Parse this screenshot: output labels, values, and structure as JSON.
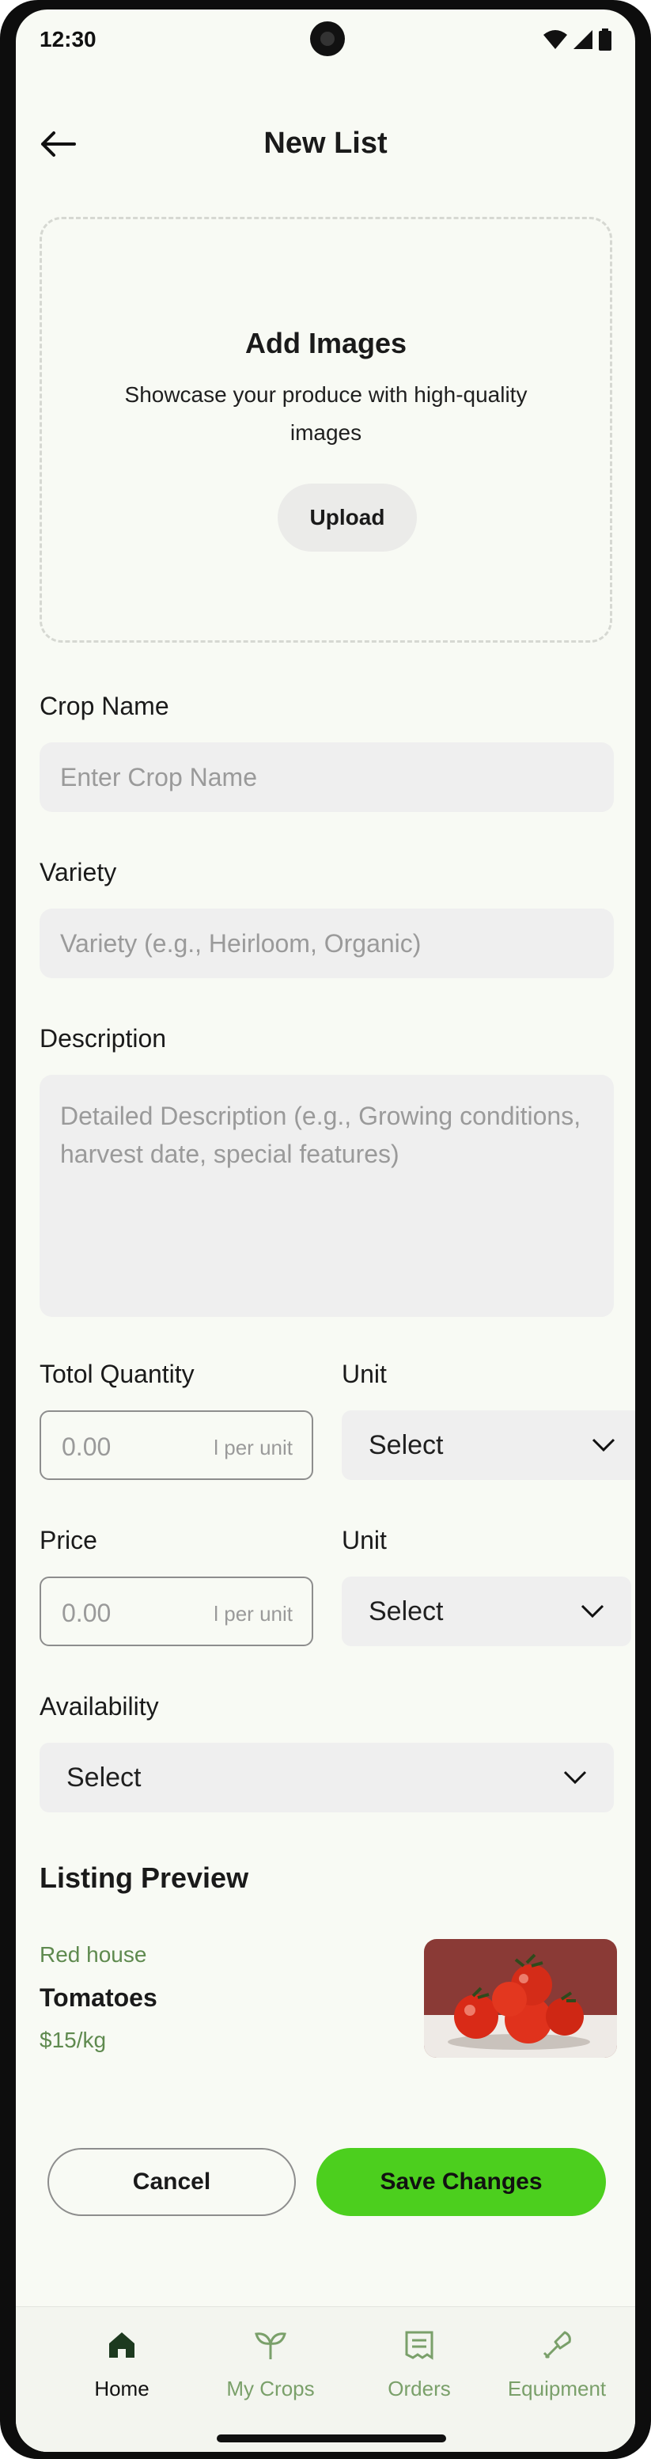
{
  "status_bar": {
    "time": "12:30"
  },
  "header": {
    "title": "New List"
  },
  "upload": {
    "title": "Add Images",
    "subtitle": "Showcase your produce with high-quality images",
    "button_label": "Upload"
  },
  "form": {
    "crop_name": {
      "label": "Crop Name",
      "placeholder": "Enter Crop Name"
    },
    "variety": {
      "label": "Variety",
      "placeholder": "Variety  (e.g., Heirloom, Organic)"
    },
    "description": {
      "label": "Description",
      "placeholder": "Detailed Description (e.g., Growing conditions, harvest date, special features)"
    },
    "total_quantity": {
      "label": "Totol Quantity",
      "placeholder": "0.00",
      "hint": "l per unit"
    },
    "quantity_unit": {
      "label": "Unit",
      "value": "Select"
    },
    "price": {
      "label": "Price",
      "placeholder": "0.00",
      "hint": "l per unit"
    },
    "price_unit": {
      "label": "Unit",
      "value": "Select"
    },
    "availability": {
      "label": "Availability",
      "value": "Select"
    }
  },
  "preview": {
    "title": "Listing Preview",
    "farm": "Red house",
    "crop": "Tomatoes",
    "price": "$15/kg",
    "image_icon": "tomatoes-image"
  },
  "actions": {
    "cancel_label": "Cancel",
    "save_label": "Save Changes"
  },
  "bottom_nav": {
    "items": [
      {
        "label": "Home",
        "icon": "home-icon",
        "active": true
      },
      {
        "label": "My Crops",
        "icon": "sprout-icon",
        "active": false
      },
      {
        "label": "Orders",
        "icon": "receipt-icon",
        "active": false
      },
      {
        "label": "Equipment",
        "icon": "tool-icon",
        "active": false
      }
    ]
  },
  "colors": {
    "accent": "#4ccf1e",
    "muted_green": "#7aa06a",
    "background": "#f8faf4"
  }
}
